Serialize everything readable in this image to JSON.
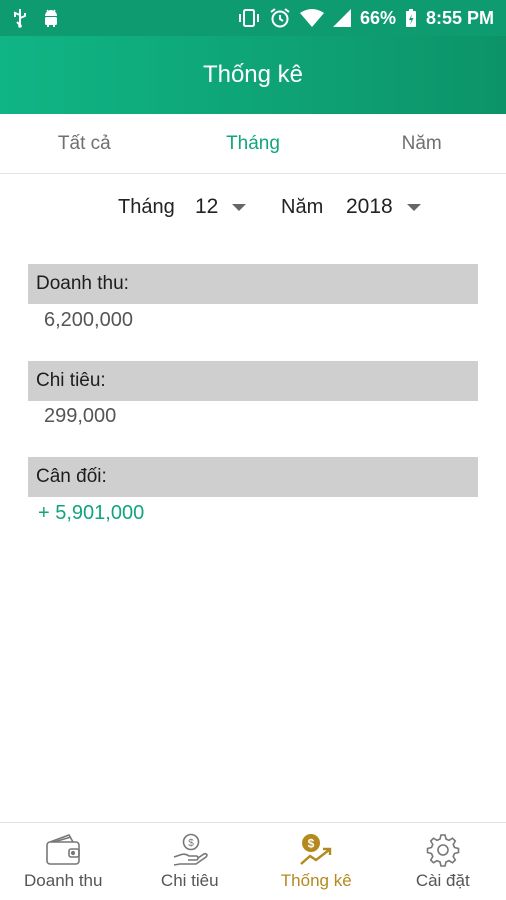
{
  "status_bar": {
    "battery": "66%",
    "time": "8:55 PM"
  },
  "app_bar": {
    "title": "Thống kê"
  },
  "tabs": [
    {
      "label": "Tất cả",
      "active": false
    },
    {
      "label": "Tháng",
      "active": true
    },
    {
      "label": "Năm",
      "active": false
    }
  ],
  "filters": {
    "month_label": "Tháng",
    "month_value": "12",
    "year_label": "Năm",
    "year_value": "2018"
  },
  "sections": {
    "revenue": {
      "label": "Doanh thu:",
      "value": "6,200,000"
    },
    "expense": {
      "label": "Chi tiêu:",
      "value": "299,000"
    },
    "balance": {
      "label": "Cân đối:",
      "value": "+ 5,901,000"
    }
  },
  "bottom_nav": [
    {
      "label": "Doanh thu",
      "icon": "wallet-icon",
      "active": false
    },
    {
      "label": "Chi tiêu",
      "icon": "hand-coin-icon",
      "active": false
    },
    {
      "label": "Thống kê",
      "icon": "trending-coin-icon",
      "active": true
    },
    {
      "label": "Cài đặt",
      "icon": "gear-icon",
      "active": false
    }
  ],
  "colors": {
    "primary": "#12a57c",
    "active_nav": "#b48a1e",
    "section_header": "#cfcfcf"
  }
}
